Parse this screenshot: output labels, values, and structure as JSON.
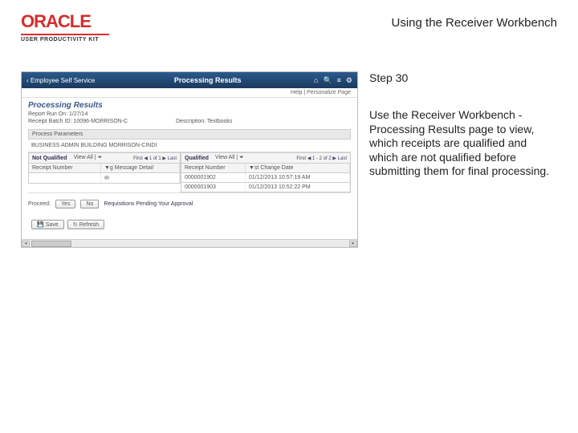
{
  "header": {
    "brand": "ORACLE",
    "product": "USER PRODUCTIVITY KIT",
    "page_title": "Using the Receiver Workbench"
  },
  "app": {
    "back_label": "‹ Employee Self Service",
    "bar_title": "Processing Results",
    "subbar": "Help | Personalize Page"
  },
  "processing": {
    "heading": "Processing Results",
    "run_on_label": "Report Run On:",
    "run_on_value": "1/27/14",
    "run_id_label": "Receipt Batch ID:",
    "run_id_value": "10096-MORRISON-C",
    "desc_label": "Description:",
    "desc_value": "Textbooks"
  },
  "params_header": "Process Parameters",
  "params_sub": "BUSINESS ADMIN BUILDING MORRISON-CINDI",
  "left_grid": {
    "tab": "Not Qualified",
    "view_all": "View All | ⏷",
    "nav": "First ◀ 1 of 1 ▶ Last",
    "col1": "Receipt Number",
    "col2": "▼g Message Detail",
    "msg_icon": "✉",
    "cell1": ""
  },
  "right_grid": {
    "tab": "Qualified",
    "view_all": "View All | ⏷",
    "nav": "First ◀ 1 - 2 of 2 ▶ Last",
    "col1": "Receipt Number",
    "col2": "▼st Change Date",
    "r1c1": "0000001902",
    "r1c2": "01/12/2013 10:57:19 AM",
    "r2c1": "0000001903",
    "r2c2": "01/12/2013 10:52:22 PM"
  },
  "proceed": {
    "label": "Proceed:",
    "yes": "Yes",
    "no": "No",
    "link": "Requisitions Pending Your Approval"
  },
  "footer": {
    "save": "Save",
    "refresh": "Refresh"
  },
  "instruction": {
    "step": "Step 30",
    "body": "Use the Receiver Workbench - Processing Results page  to view, which receipts\nare qualified and which are not qualified before submitting them for final processing."
  }
}
